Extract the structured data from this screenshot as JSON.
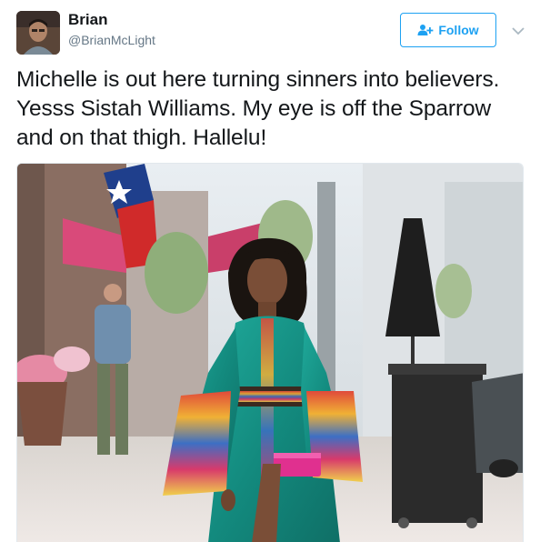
{
  "author": {
    "display_name": "Brian",
    "handle": "@BrianMcLight",
    "avatar_icon": "avatar-photo"
  },
  "follow": {
    "label": "Follow",
    "icon": "add-user-icon",
    "color": "#1da1f2"
  },
  "menu": {
    "icon": "chevron-down-icon"
  },
  "tweet": {
    "text": "Michelle is out here turning sinners into believers. Yesss Sistah Williams. My eye is off the Sparrow and on that thigh. Hallelu!"
  },
  "media": {
    "icon": "photo-woman-teal-dress"
  }
}
